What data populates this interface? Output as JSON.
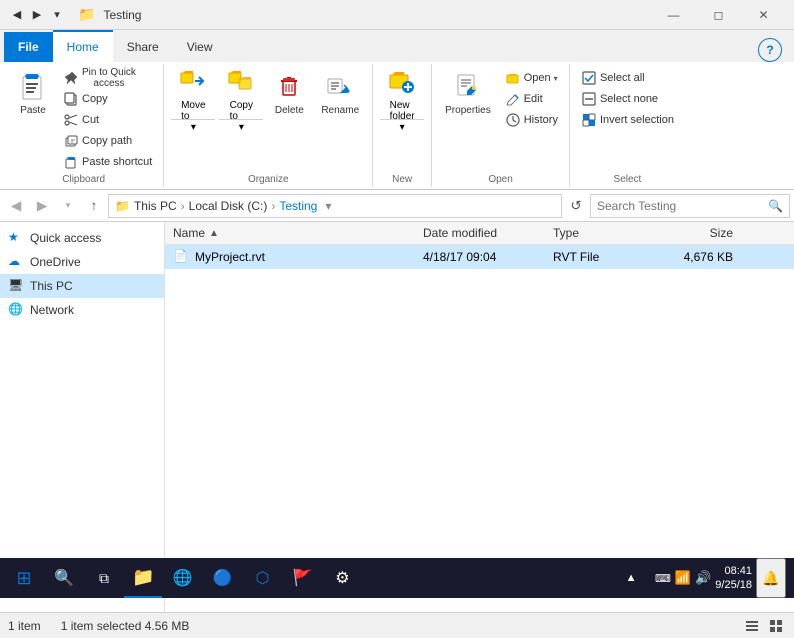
{
  "window": {
    "title": "Testing",
    "icon": "📁"
  },
  "qat": {
    "buttons": [
      "▼",
      "⬅",
      "↑"
    ]
  },
  "tabs": {
    "file": "File",
    "home": "Home",
    "share": "Share",
    "view": "View"
  },
  "ribbon": {
    "clipboard": {
      "label": "Clipboard",
      "pin_label": "Pin to Quick\naccess",
      "copy_label": "Copy",
      "paste_label": "Paste",
      "cut_label": "Cut",
      "copy_path_label": "Copy path",
      "paste_shortcut_label": "Paste shortcut"
    },
    "organize": {
      "label": "Organize",
      "move_label": "Move\nto",
      "copy_label": "Copy\nto",
      "delete_label": "Delete",
      "rename_label": "Rename"
    },
    "new": {
      "label": "New",
      "new_folder_label": "New\nfolder"
    },
    "open": {
      "label": "Open",
      "open_label": "Open",
      "edit_label": "Edit",
      "history_label": "History",
      "properties_label": "Properties"
    },
    "select": {
      "label": "Select",
      "select_all_label": "Select all",
      "select_none_label": "Select none",
      "invert_label": "Invert selection"
    }
  },
  "addressbar": {
    "back_disabled": true,
    "forward_disabled": true,
    "up_enabled": true,
    "path": {
      "thispc": "This PC",
      "localdisk": "Local Disk (C:)",
      "folder": "Testing"
    },
    "search_placeholder": "Search Testing",
    "search_label": "Search"
  },
  "nav": {
    "items": [
      {
        "label": "Quick access",
        "icon": "star"
      },
      {
        "label": "OneDrive",
        "icon": "cloud"
      },
      {
        "label": "This PC",
        "icon": "pc",
        "active": true
      },
      {
        "label": "Network",
        "icon": "network"
      }
    ]
  },
  "files": {
    "columns": {
      "name": "Name",
      "date_modified": "Date modified",
      "type": "Type",
      "size": "Size"
    },
    "rows": [
      {
        "name": "MyProject.rvt",
        "date": "4/18/17 09:04",
        "type": "RVT File",
        "size": "4,676 KB",
        "selected": true
      }
    ]
  },
  "statusbar": {
    "item_count": "1 item",
    "selected_info": "1 item selected  4.56 MB"
  },
  "taskbar": {
    "time": "08:41",
    "date": "9/25/18",
    "tray_icons": [
      "🔔",
      "🌐",
      "🔊",
      "⌨"
    ]
  }
}
